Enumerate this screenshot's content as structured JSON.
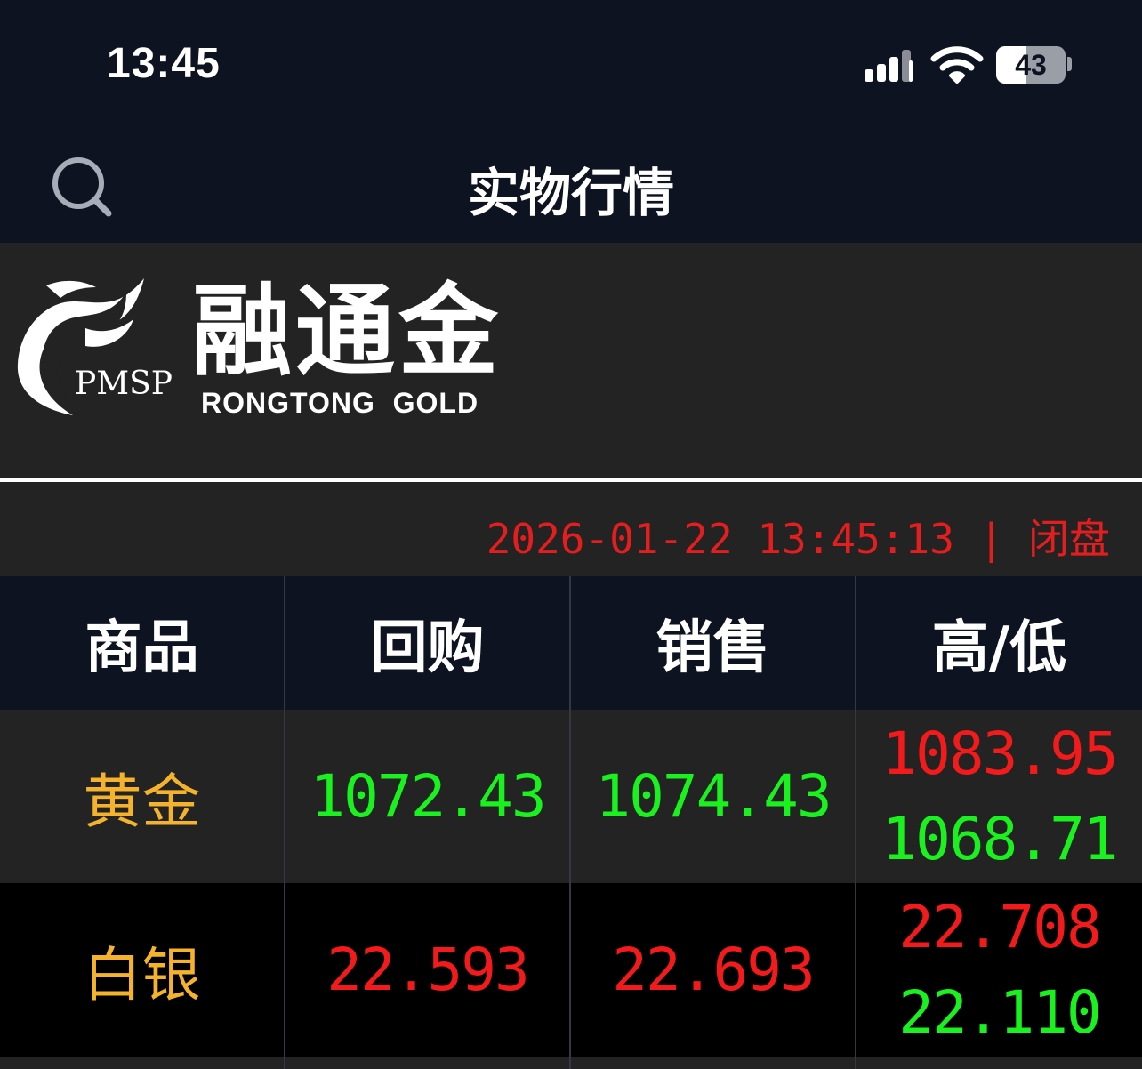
{
  "status_bar": {
    "time": "13:45",
    "battery": "43",
    "battery_level": 0.43,
    "icons": [
      "signal-icon",
      "wifi-icon",
      "battery-icon"
    ]
  },
  "nav": {
    "title": "实物行情",
    "search_icon": "search-icon"
  },
  "banner": {
    "logo_cn": "融通金",
    "logo_en": "RONGTONG  GOLD",
    "logo_pmsp": "PMSP"
  },
  "timestamp": {
    "text": "2026-01-22 13:45:13 | 闭盘"
  },
  "table": {
    "headers": [
      "商品",
      "回购",
      "销售",
      "高/低"
    ],
    "rows": [
      {
        "name": "黄金",
        "buyback": "1072.43",
        "sell": "1074.43",
        "high": "1083.95",
        "low": "1068.71"
      },
      {
        "name": "白银",
        "buyback": "22.593",
        "sell": "22.693",
        "high": "22.708",
        "low": "22.110"
      }
    ]
  },
  "colors": {
    "background": "#0d1320",
    "panel": "#232323",
    "up": "#19f21e",
    "down": "#f21a1a",
    "product_name": "#f5b32c"
  }
}
